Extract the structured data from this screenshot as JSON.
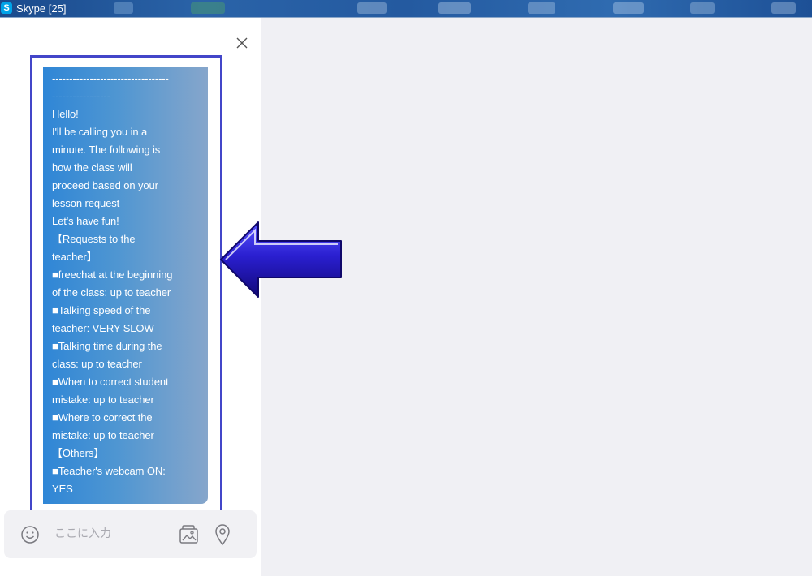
{
  "window": {
    "title": "Skype [25]",
    "app_icon_letter": "S"
  },
  "chat": {
    "message_lines": [
      "----------------------------------",
      "-----------------",
      "Hello!",
      "I'll be calling you in a",
      "minute. The following is",
      "how the class will",
      "proceed based on your",
      "lesson request",
      "Let's have fun!",
      "【Requests to the",
      "teacher】",
      "■freechat at the beginning",
      "of the class: up to teacher",
      "■Talking speed of the",
      "teacher: VERY SLOW",
      "■Talking time during the",
      "class: up to teacher",
      "■When to correct student",
      "mistake: up to teacher",
      "■Where to correct the",
      "mistake: up to teacher",
      "【Others】",
      "■Teacher's webcam ON:",
      "YES"
    ]
  },
  "composer": {
    "placeholder": "ここに入力",
    "emoji_icon": "smiley-icon",
    "media_icon": "gallery-icon",
    "location_icon": "location-pin-icon"
  },
  "colors": {
    "bubble_start": "#2f86d6",
    "bubble_end": "#86a6cb",
    "highlight": "#4346c9",
    "arrow": "#2a1fd0",
    "right_panel": "#f0f0f4"
  }
}
